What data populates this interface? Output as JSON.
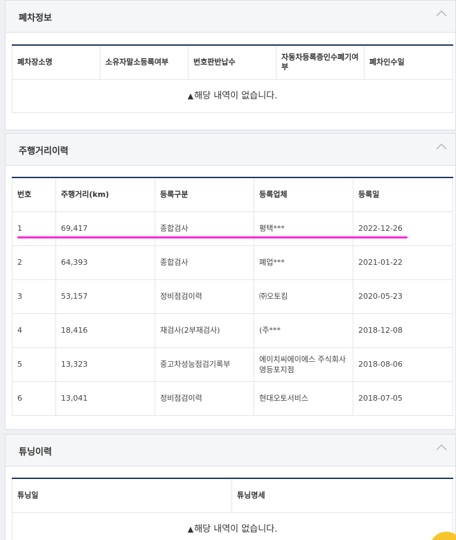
{
  "scrap": {
    "title": "폐차정보",
    "headers": [
      "폐차장소명",
      "소유자말소등록여부",
      "번호판반납수",
      "자동차등록증인수폐기여부",
      "폐차인수일"
    ],
    "empty_message": "해당 내역이 없습니다."
  },
  "mileage": {
    "title": "주행거리이력",
    "headers": [
      "번호",
      "주행거리(km)",
      "등록구분",
      "등록업체",
      "등록일"
    ],
    "rows": [
      [
        "1",
        "69,417",
        "종합검사",
        "평택***",
        "2022-12-26"
      ],
      [
        "2",
        "64,393",
        "종합검사",
        "폐업***",
        "2021-01-22"
      ],
      [
        "3",
        "53,157",
        "정비점검이력",
        "㈜오토킹",
        "2020-05-23"
      ],
      [
        "4",
        "18,416",
        "재검사(2부재검사)",
        "(주***",
        "2018-12-08"
      ],
      [
        "5",
        "13,323",
        "중고차성능점검기록부",
        "에이치씨에이에스 주식회사 영등포지점",
        "2018-08-06"
      ],
      [
        "6",
        "13,041",
        "정비점검이력",
        "현대오토서비스",
        "2018-07-05"
      ]
    ]
  },
  "tuning": {
    "title": "튜닝이력",
    "headers": [
      "튜닝일",
      "튜닝명세"
    ],
    "empty_message": "해당 내역이 없습니다."
  },
  "colors": {
    "header_line": "#203864",
    "highlight": "#ff2ad8",
    "fab": "#f7c52b"
  },
  "icons": {
    "collapse": "chevron-up-icon",
    "warning": "warning-triangle-icon"
  }
}
